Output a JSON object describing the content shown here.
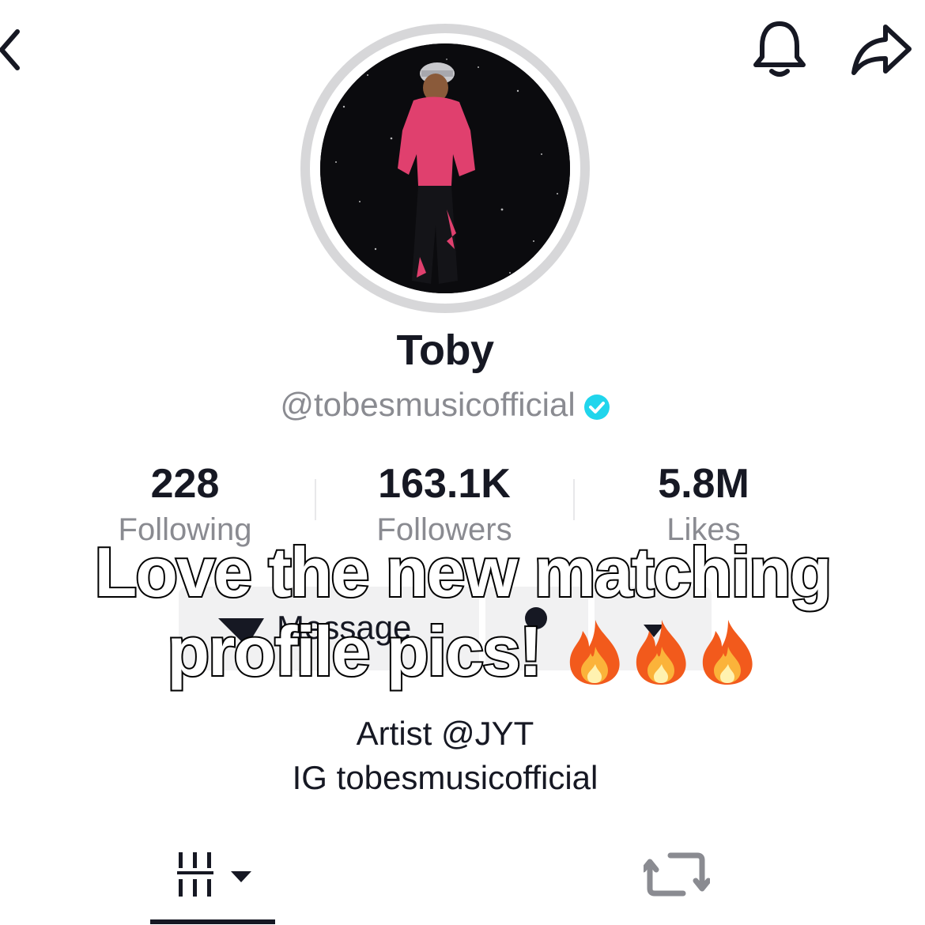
{
  "profile": {
    "name": "Toby",
    "handle": "@tobesmusicofficial",
    "stats": [
      {
        "value": "228",
        "label": "Following"
      },
      {
        "value": "163.1K",
        "label": "Followers"
      },
      {
        "value": "5.8M",
        "label": "Likes"
      }
    ],
    "bio_line1": "Artist @JYT",
    "bio_line2": "IG tobesmusicofficial"
  },
  "actions": {
    "message_label": "Message"
  },
  "caption": {
    "line1": "Love the new matching",
    "line2": "profile pics!"
  },
  "colors": {
    "verified": "#20d5ec",
    "hoodie": "#e0406e",
    "text_primary": "#161823",
    "text_secondary": "#8a8b91"
  },
  "icons": [
    "back-icon",
    "bell-icon",
    "share-icon",
    "verified-icon",
    "grid-icon",
    "repost-icon",
    "fire-emoji"
  ]
}
